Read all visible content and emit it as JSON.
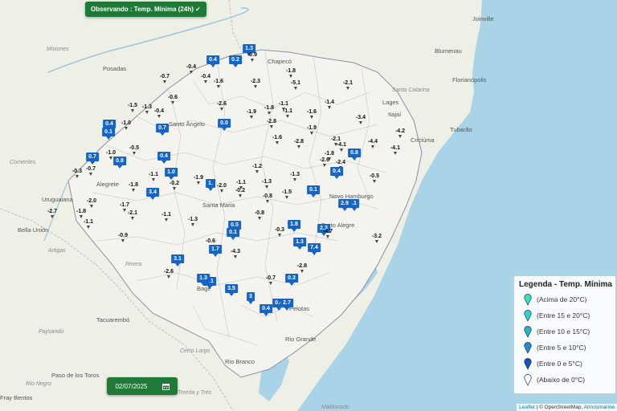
{
  "top_button": {
    "label": "Observando : Temp. Mínima (24h) ✓"
  },
  "date_control": {
    "value": "02/07/2025",
    "icon": "calendar-icon"
  },
  "legend": {
    "title": "Legenda - Temp. Mínima",
    "items": [
      {
        "label": "(Acima de 20°C)",
        "color": "#2ee6c2"
      },
      {
        "label": "(Entre 15 e 20°C)",
        "color": "#27d3d8"
      },
      {
        "label": "(Entre 10 e 15°C)",
        "color": "#1fb7d6"
      },
      {
        "label": "(Entre 5 e 10°C)",
        "color": "#2489d6"
      },
      {
        "label": "(Entre 0 e 5°C)",
        "color": "#1150c8"
      },
      {
        "label": "(Abaixo de 0°C)",
        "color": "#ffffff"
      }
    ]
  },
  "attribution": {
    "leaflet": "Leaflet",
    "osm": "| © OpenStreetMap,",
    "atmos": "Atmosmarine"
  },
  "colors": {
    "positive_marker": "#1565c8",
    "button_green": "#1e7a36",
    "ocean": "#a9d3e7",
    "land": "#eef0e6"
  },
  "places": [
    {
      "name": "Chapecó",
      "kind": "city"
    },
    {
      "name": "Joinville",
      "kind": "city"
    },
    {
      "name": "Blumenau",
      "kind": "city"
    },
    {
      "name": "Florianópolis",
      "kind": "city"
    },
    {
      "name": "Posadas",
      "kind": "city"
    },
    {
      "name": "Santa Catarina",
      "kind": "region"
    },
    {
      "name": "Misiones",
      "kind": "region"
    },
    {
      "name": "Corrientes",
      "kind": "region"
    },
    {
      "name": "Uruguaiana",
      "kind": "city"
    },
    {
      "name": "Bella Unión",
      "kind": "city"
    },
    {
      "name": "Artigas",
      "kind": "region"
    },
    {
      "name": "Rivera",
      "kind": "region"
    },
    {
      "name": "Tacuarembó",
      "kind": "city"
    },
    {
      "name": "Paysandú",
      "kind": "region"
    },
    {
      "name": "Cerro Largo",
      "kind": "region"
    },
    {
      "name": "Paso de los Toros",
      "kind": "city"
    },
    {
      "name": "Río Negro",
      "kind": "region"
    },
    {
      "name": "Fray Bentos",
      "kind": "city"
    },
    {
      "name": "Treinta y Tres",
      "kind": "region"
    },
    {
      "name": "Santa Maria",
      "kind": "city"
    },
    {
      "name": "Porto Alegre",
      "kind": "city"
    },
    {
      "name": "Novo Hamburgo",
      "kind": "city"
    },
    {
      "name": "Lages",
      "kind": "city"
    },
    {
      "name": "Criciúma",
      "kind": "city"
    },
    {
      "name": "Tubarão",
      "kind": "city"
    },
    {
      "name": "Pelotas",
      "kind": "city"
    },
    {
      "name": "Rio Grande",
      "kind": "city"
    },
    {
      "name": "Rio Branco",
      "kind": "city"
    },
    {
      "name": "Maldonado",
      "kind": "region"
    },
    {
      "name": "Itajaí",
      "kind": "city"
    },
    {
      "name": "Alegrete",
      "kind": "city"
    },
    {
      "name": "Santo Ângelo",
      "kind": "city"
    },
    {
      "name": "Bagé",
      "kind": "city"
    }
  ],
  "stations": [
    {
      "value": "1.3",
      "style": "blue"
    },
    {
      "value": "0.4",
      "style": "blue"
    },
    {
      "value": "0.2",
      "style": "blue"
    },
    {
      "value": "-0.9",
      "style": "white"
    },
    {
      "value": "-0.4",
      "style": "white"
    },
    {
      "value": "-0.7",
      "style": "white"
    },
    {
      "value": "-1.8",
      "style": "white"
    },
    {
      "value": "-0.4",
      "style": "white"
    },
    {
      "value": "-1.6",
      "style": "white"
    },
    {
      "value": "-2.3",
      "style": "white"
    },
    {
      "value": "-5.1",
      "style": "white"
    },
    {
      "value": "-2.1",
      "style": "white"
    },
    {
      "value": "-0.6",
      "style": "white"
    },
    {
      "value": "-2.6",
      "style": "white"
    },
    {
      "value": "-1.1",
      "style": "white"
    },
    {
      "value": "-1.3",
      "style": "white"
    },
    {
      "value": "-0.4",
      "style": "white"
    },
    {
      "value": "-1.9",
      "style": "white"
    },
    {
      "value": "-1.8",
      "style": "white"
    },
    {
      "value": "-1.1",
      "style": "white"
    },
    {
      "value": "-1.4",
      "style": "white"
    },
    {
      "value": "-1.5",
      "style": "white"
    },
    {
      "value": "-2.8",
      "style": "white"
    },
    {
      "value": "-1.6",
      "style": "white"
    },
    {
      "value": "-3.4",
      "style": "white"
    },
    {
      "value": "0.4",
      "style": "blue"
    },
    {
      "value": "0.1",
      "style": "blue"
    },
    {
      "value": "-1.0",
      "style": "white"
    },
    {
      "value": "0.7",
      "style": "blue"
    },
    {
      "value": "0.0",
      "style": "blue"
    },
    {
      "value": "-1.9",
      "style": "white"
    },
    {
      "value": "-4.2",
      "style": "white"
    },
    {
      "value": "-1.6",
      "style": "white"
    },
    {
      "value": "-2.8",
      "style": "white"
    },
    {
      "value": "-2.1",
      "style": "white"
    },
    {
      "value": "-4.1",
      "style": "white"
    },
    {
      "value": "-4.4",
      "style": "white"
    },
    {
      "value": "-4.1",
      "style": "white"
    },
    {
      "value": "-0.5",
      "style": "white"
    },
    {
      "value": "-1.0",
      "style": "white"
    },
    {
      "value": "0.7",
      "style": "blue"
    },
    {
      "value": "0.4",
      "style": "blue"
    },
    {
      "value": "0.8",
      "style": "blue"
    },
    {
      "value": "-0.3",
      "style": "white"
    },
    {
      "value": "-0.7",
      "style": "white"
    },
    {
      "value": "-1.2",
      "style": "white"
    },
    {
      "value": "-1.8",
      "style": "white"
    },
    {
      "value": "-2.6",
      "style": "white"
    },
    {
      "value": "-2.4",
      "style": "white"
    },
    {
      "value": "0.8",
      "style": "blue"
    },
    {
      "value": "-1.1",
      "style": "white"
    },
    {
      "value": "1.0",
      "style": "blue"
    },
    {
      "value": "-1.9",
      "style": "white"
    },
    {
      "value": "-1.3",
      "style": "white"
    },
    {
      "value": "0.4",
      "style": "blue"
    },
    {
      "value": "-0.5",
      "style": "white"
    },
    {
      "value": "-1.8",
      "style": "white"
    },
    {
      "value": "-0.2",
      "style": "white"
    },
    {
      "value": "1.",
      "style": "blue"
    },
    {
      "value": "-2.0",
      "style": "white"
    },
    {
      "value": "-1.1",
      "style": "white"
    },
    {
      "value": "-1.3",
      "style": "white"
    },
    {
      "value": "0.1",
      "style": "blue"
    },
    {
      "value": "3.4",
      "style": "blue"
    },
    {
      "value": "-0.2",
      "style": "white"
    },
    {
      "value": "-0.8",
      "style": "white"
    },
    {
      "value": "-1.5",
      "style": "white"
    },
    {
      "value": "-2.0",
      "style": "white"
    },
    {
      "value": "-1.7",
      "style": "white"
    },
    {
      "value": "2.9",
      "style": "blue"
    },
    {
      "value": ".1",
      "style": "blue"
    },
    {
      "value": "-2.7",
      "style": "white"
    },
    {
      "value": "-1.8",
      "style": "white"
    },
    {
      "value": "-2.1",
      "style": "white"
    },
    {
      "value": "-1.1",
      "style": "white"
    },
    {
      "value": "-1.3",
      "style": "white"
    },
    {
      "value": "-0.8",
      "style": "white"
    },
    {
      "value": "-1.1",
      "style": "white"
    },
    {
      "value": "1.8",
      "style": "blue"
    },
    {
      "value": "0.5",
      "style": "blue"
    },
    {
      "value": "0.1",
      "style": "blue"
    },
    {
      "value": "-0.3",
      "style": "white"
    },
    {
      "value": "2.3",
      "style": "blue"
    },
    {
      "value": "-4.7",
      "style": "white"
    },
    {
      "value": "-0.9",
      "style": "white"
    },
    {
      "value": "-0.6",
      "style": "white"
    },
    {
      "value": "1.7",
      "style": "blue"
    },
    {
      "value": "1.3",
      "style": "blue"
    },
    {
      "value": "7.4",
      "style": "blue"
    },
    {
      "value": "-3.2",
      "style": "white"
    },
    {
      "value": "-4.3",
      "style": "white"
    },
    {
      "value": "3.1",
      "style": "blue"
    },
    {
      "value": "-2.8",
      "style": "white"
    },
    {
      "value": "-2.6",
      "style": "white"
    },
    {
      "value": "0.1",
      "style": "blue"
    },
    {
      "value": "1.3",
      "style": "blue"
    },
    {
      "value": "-0.7",
      "style": "white"
    },
    {
      "value": "0.3",
      "style": "blue"
    },
    {
      "value": "3.5",
      "style": "blue"
    },
    {
      "value": "3",
      "style": "blue"
    },
    {
      "value": "0.4",
      "style": "blue"
    },
    {
      "value": "2.7",
      "style": "blue"
    },
    {
      "value": "0.4",
      "style": "blue"
    }
  ]
}
